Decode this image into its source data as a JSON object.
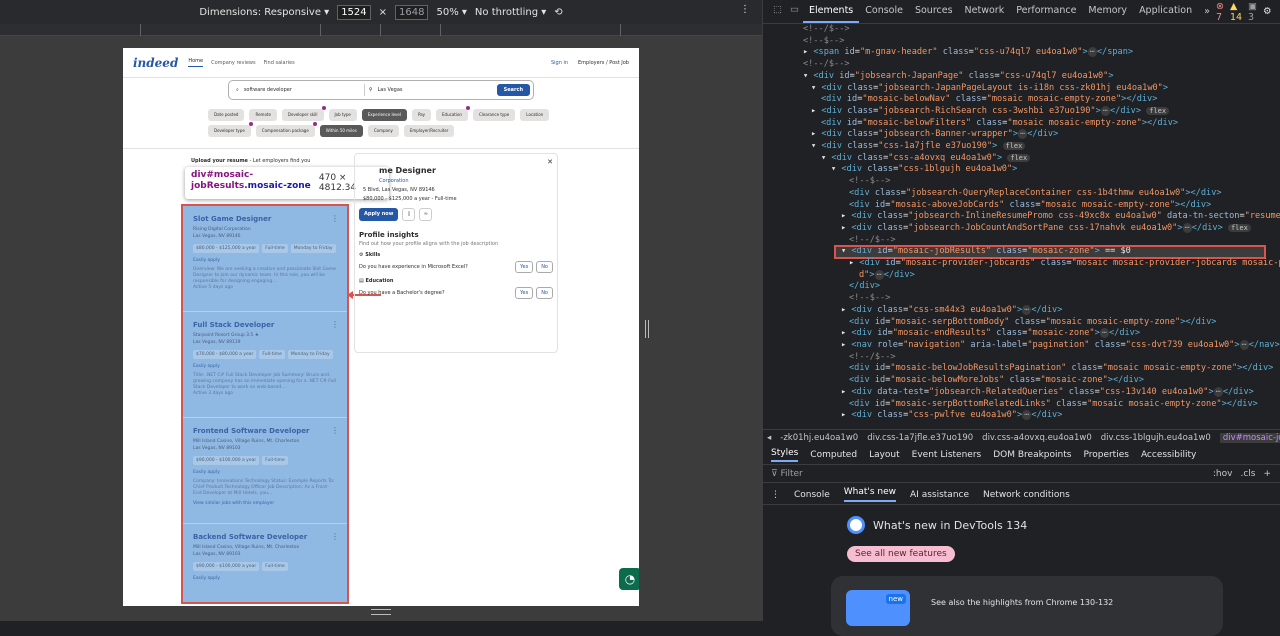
{
  "devbar": {
    "dimensions_label": "Dimensions: Responsive",
    "width": "1524",
    "times": "×",
    "height": "1648",
    "zoom": "50%",
    "throttling": "No throttling"
  },
  "page": {
    "logo": "indeed",
    "nav": [
      "Home",
      "Company reviews",
      "Find salaries"
    ],
    "sign_in": "Sign in",
    "employers": "Employers / Post Job",
    "search_what": "software developer",
    "search_where": "Las Vegas",
    "search_button": "Search",
    "chips": [
      {
        "label": "Date posted",
        "dot": false,
        "dark": false
      },
      {
        "label": "Remote",
        "dot": false,
        "dark": false
      },
      {
        "label": "Developer skill",
        "dot": true,
        "dark": false
      },
      {
        "label": "Job type",
        "dot": false,
        "dark": false
      },
      {
        "label": "Experience level",
        "dot": false,
        "dark": true
      },
      {
        "label": "Pay",
        "dot": false,
        "dark": false
      },
      {
        "label": "Education",
        "dot": true,
        "dark": false
      },
      {
        "label": "Clearance type",
        "dot": false,
        "dark": false
      },
      {
        "label": "Location",
        "dot": false,
        "dark": false
      },
      {
        "label": "Developer type",
        "dot": true,
        "dark": false
      },
      {
        "label": "Compensation package",
        "dot": true,
        "dark": false
      },
      {
        "label": "Within 50 miles",
        "dot": false,
        "dark": true
      },
      {
        "label": "Company",
        "dot": false,
        "dark": false
      },
      {
        "label": "Employer/Recruiter",
        "dot": false,
        "dark": false
      }
    ],
    "promo_bold": "Upload your resume",
    "promo_rest": " - Let employers find you",
    "tooltip_id": "div#mosaic-jobResults",
    "tooltip_class": ".mosaic-zone",
    "tooltip_dims": "470 × 4812.34",
    "jobs": [
      {
        "title": "Slot Game Designer",
        "company": "Rising Digital Corporation",
        "location": "Las Vegas, NV 89146",
        "tags": [
          "$80,000 - $125,000 a year",
          "Full-time",
          "Monday to Friday"
        ],
        "easy": "Easily apply",
        "desc": "Overview: We are seeking a creative and passionate Slot Game Designer to join our dynamic team. In this role, you will be responsible for designing engaging...",
        "age": "Active 5 days ago"
      },
      {
        "title": "Full Stack Developer",
        "company": "Starpoint Resort Group 3.5 ★",
        "location": "Las Vegas, NV 89119",
        "tags": [
          "$70,000 - $80,000 a year",
          "Full-time",
          "Monday to Friday"
        ],
        "easy": "Easily apply",
        "desc": "Title: .NET C# Full Stack Developer Job Summary: Bruce and growing company has an immediate opening for a .NET C# Full Stack Developer to work on web-based...",
        "age": "Active 3 days ago"
      },
      {
        "title": "Frontend Software Developer",
        "company": "Mill Island Casino, Village Ruins, Mt. Charleston",
        "location": "Las Vegas, NV 89103",
        "tags": [
          "$90,000 - $100,000 a year",
          "Full-time"
        ],
        "easy": "Easily apply",
        "desc": "Company: Innovations Technology Status: Example Reports To: Chief Product Technology Officer Job Description: As a Front-End Developer at Mill Hotels, you...",
        "more": "View similar jobs with this employer",
        "age": ""
      },
      {
        "title": "Backend Software Developer",
        "company": "Mill Island Casino, Village Ruins, Mt. Charleston",
        "location": "Las Vegas, NV 89103",
        "tags": [
          "$90,000 - $100,000 a year",
          "Full-time"
        ],
        "easy": "Easily apply",
        "desc": "",
        "age": ""
      }
    ],
    "detail": {
      "title": "me Designer",
      "company": "Corporation",
      "address": "5 Blvd, Las Vegas, NV 89146",
      "pay": "$80,000 - $125,000 a year  -  Full-time",
      "apply": "Apply now",
      "insights": "Profile insights",
      "insights_sub": "Find out how your profile aligns with the job description",
      "skills": "Skills",
      "skills_q": "Do you have experience in Microsoft Excel?",
      "education": "Education",
      "education_q": "Do you have a Bachelor's degree?",
      "yes": "Yes",
      "no": "No"
    }
  },
  "devtools": {
    "tabs": [
      "Elements",
      "Console",
      "Sources",
      "Network",
      "Performance",
      "Memory",
      "Application"
    ],
    "more": "»",
    "errors": "7",
    "warnings": "14",
    "infos": "3",
    "crumbs": [
      "-zk01hj.eu4oa1w0",
      "div.css-1a7jfle.e37uo190",
      "div.css-a4ovxq.eu4oa1w0",
      "div.css-1blgujh.eu4oa1w0",
      "div#mosaic-jobResults.mosaic-zone"
    ],
    "style_tabs": [
      "Styles",
      "Computed",
      "Layout",
      "Event Listeners",
      "DOM Breakpoints",
      "Properties",
      "Accessibility"
    ],
    "filter_placeholder": "Filter",
    "filter_right": [
      ":hov",
      ".cls",
      "+"
    ],
    "drawer_tabs": [
      "Console",
      "What's new",
      "AI assistance",
      "Network conditions"
    ],
    "whats_new_title": "What's new in DevTools 134",
    "see_all": "See all new features",
    "card_badge": "new",
    "card_text": "See also the highlights from Chrome 130-132"
  }
}
